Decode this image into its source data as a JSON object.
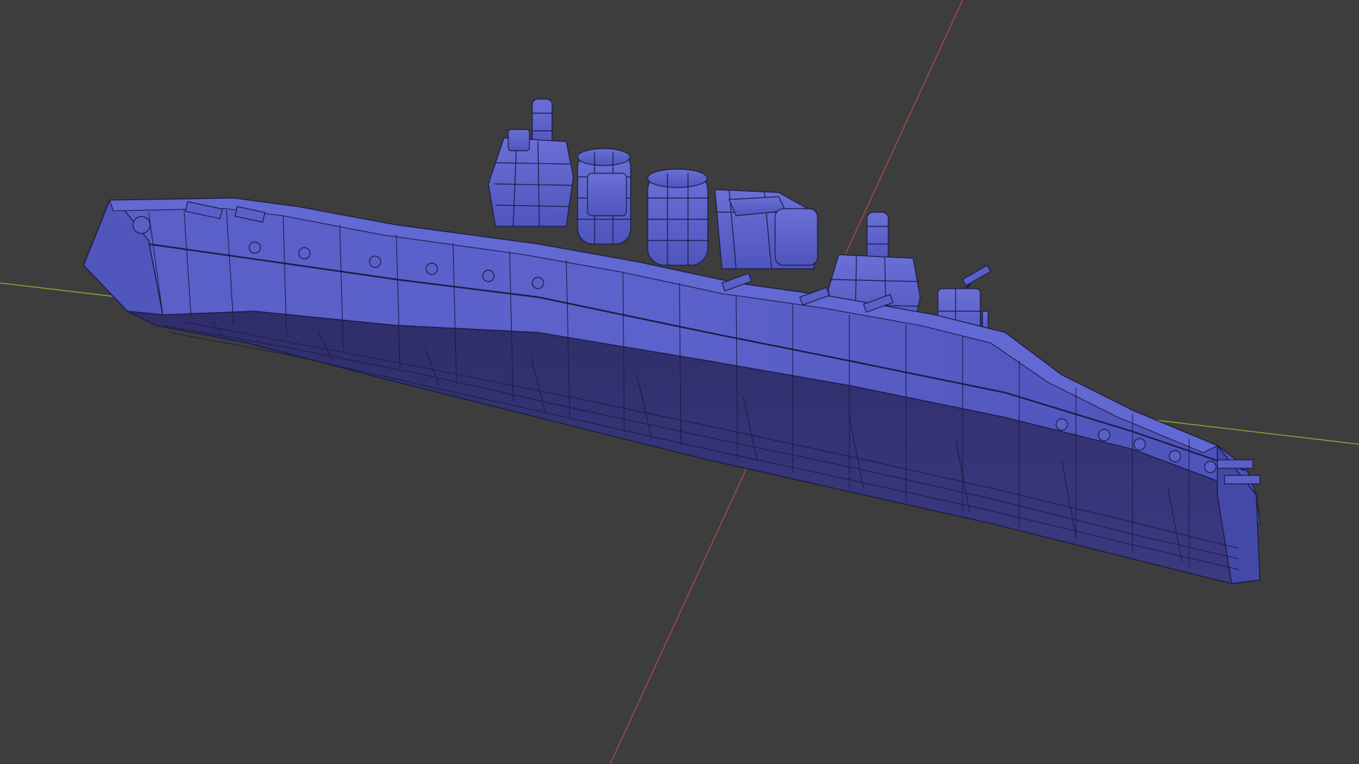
{
  "viewport": {
    "background_color": "#3d3d3d",
    "shading_mode": "wireframe-on-solid",
    "axes": {
      "x_axis_color": "#b84848",
      "y_axis_color": "#83b236"
    },
    "model": {
      "name": "",
      "base_color": "#5b61c9",
      "hull_shadow_color": "#343374",
      "wire_color": "#1c1b45"
    }
  }
}
